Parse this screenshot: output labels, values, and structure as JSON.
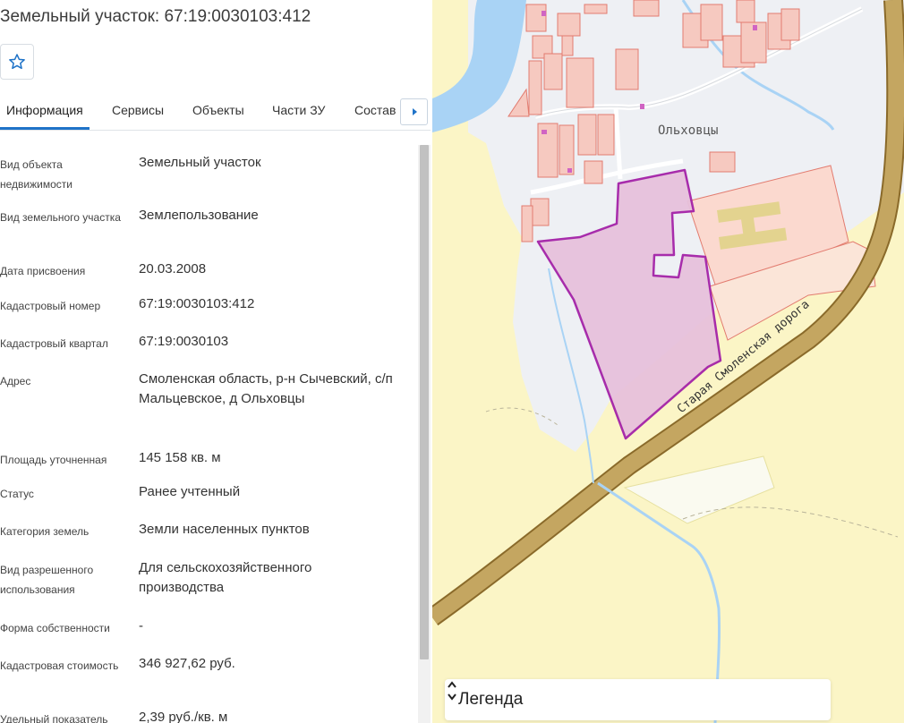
{
  "header": {
    "title": "Земельный участок: 67:19:0030103:412"
  },
  "actions": {
    "favorite_icon": "star-outline-icon"
  },
  "tabs": [
    {
      "label": "Информация",
      "active": true
    },
    {
      "label": "Сервисы"
    },
    {
      "label": "Объекты"
    },
    {
      "label": "Части ЗУ"
    },
    {
      "label": "Состав"
    }
  ],
  "fields": [
    {
      "label": "Вид объекта недвижимости",
      "value": "Земельный участок"
    },
    {
      "label": "Вид земельного участка",
      "value": "Землепользование"
    },
    {
      "label": "Дата присвоения",
      "value": "20.03.2008"
    },
    {
      "label": "Кадастровый номер",
      "value": "67:19:0030103:412"
    },
    {
      "label": "Кадастровый квартал",
      "value": "67:19:0030103"
    },
    {
      "label": "Адрес",
      "value": "Смоленская область, р-н Сычевский, с/п Мальцевское, д Ольховцы"
    },
    {
      "label": "Площадь уточненная",
      "value": "145 158 кв. м"
    },
    {
      "label": "Статус",
      "value": "Ранее учтенный"
    },
    {
      "label": "Категория земель",
      "value": "Земли населенных пунктов"
    },
    {
      "label": "Вид разрешенного использования",
      "value": "Для сельскохозяйственного производства"
    },
    {
      "label": "Форма собственности",
      "value": "-"
    },
    {
      "label": "Кадастровая стоимость",
      "value": "346 927,62 руб."
    },
    {
      "label": "Удельный показатель",
      "value": "2,39 руб./кв. м"
    }
  ],
  "map": {
    "village_label": "Ольховцы",
    "road_label": "Старая Смоленская дорога",
    "colors": {
      "fields": "#fbf5c6",
      "settlement": "#eef0f4",
      "water": "#a9d3f5",
      "road": "#c4a661",
      "parcel_fill": "#e7c1dc",
      "parcel_stroke": "#a422a8",
      "buildings": "#f6c9c0",
      "buildings_stroke": "#e27b6f"
    }
  },
  "legend": {
    "label": "Легенда"
  }
}
